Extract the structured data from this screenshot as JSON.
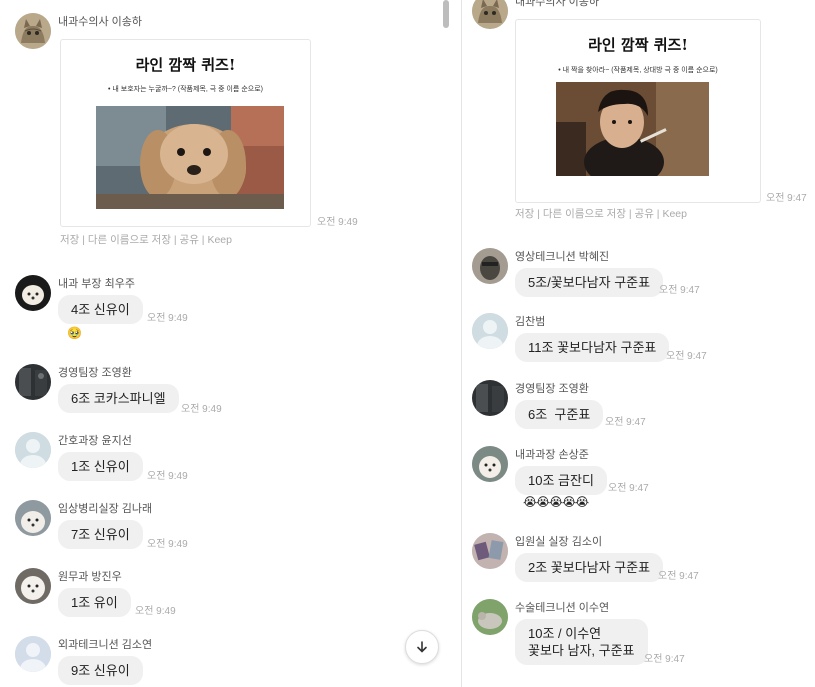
{
  "left": {
    "card_message": {
      "sender": "내과수의사 이송하",
      "card_title": "라인 깜짝 퀴즈!",
      "card_subtitle": "• 내 보호자는 누굴까~? (작품제목, 극 중 이름 순으로)",
      "time": "오전 9:49",
      "actions": "저장 | 다른 이름으로 저장 | 공유 | Keep"
    },
    "messages": [
      {
        "sender": "내과 부장 최우주",
        "text": "4조 신유이",
        "time": "오전 9:49",
        "emoji": "🥹"
      },
      {
        "sender": "경영팀장 조영환",
        "text": "6조 코카스파니엘",
        "time": "오전 9:49"
      },
      {
        "sender": "간호과장 윤지선",
        "text": "1조 신유이",
        "time": "오전 9:49"
      },
      {
        "sender": "임상병리실장 김나래",
        "text": "7조 신유이",
        "time": "오전 9:49"
      },
      {
        "sender": "원무과 방진우",
        "text": "1조 유이",
        "time": "오전 9:49"
      },
      {
        "sender": "외과테크니션 김소연",
        "text": "9조 신유이"
      }
    ]
  },
  "right": {
    "card_message": {
      "sender": "내과수의사 이송하",
      "card_title": "라인 깜짝 퀴즈!",
      "card_subtitle": "• 내 짝을 찾아라~ (작품제목, 상대방 극 중 이름 순으로)",
      "time": "오전 9:47",
      "actions": "저장 | 다른 이름으로 저장 | 공유 | Keep"
    },
    "messages": [
      {
        "sender": "영상테크니션 박혜진",
        "text": "5조/꽃보다남자 구준표",
        "time": "오전 9:47"
      },
      {
        "sender": "김찬범",
        "text": "11조 꽃보다남자 구준표",
        "time": "오전 9:47"
      },
      {
        "sender": "경영팀장 조영환",
        "text": "6조  구준표",
        "time": "오전 9:47"
      },
      {
        "sender": "내과과장 손상준",
        "text": "10조 금잔디",
        "time": "오전 9:47",
        "emoji": "😭😭😭😭😭"
      },
      {
        "sender": "입원실 실장 김소이",
        "text": "2조 꽃보다남자 구준표",
        "time": "오전 9:47"
      },
      {
        "sender": "수술테크니션 이수연",
        "text_line1": "10조 / 이수연",
        "text_line2": "꽃보다 남자, 구준표",
        "time": "오전 9:47"
      }
    ]
  },
  "icons": {
    "scroll_down": "arrow-down-icon"
  },
  "colors": {
    "bubble": "#f0f0f0",
    "time": "#aaaaaa",
    "name": "#555555"
  }
}
